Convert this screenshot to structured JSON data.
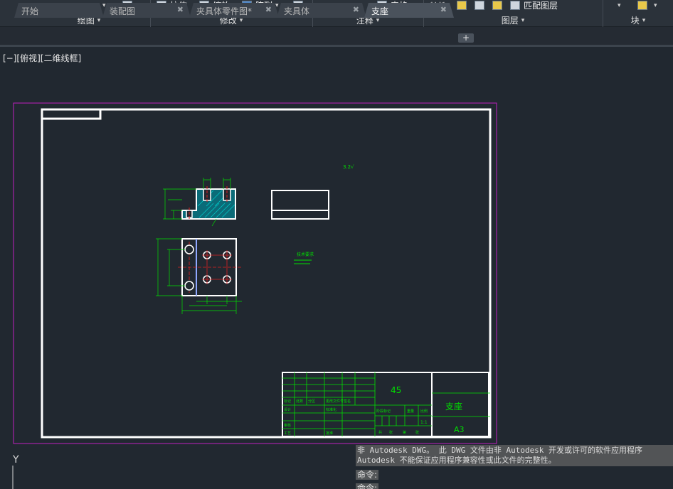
{
  "ribbon": {
    "draw_panel": "绘图",
    "modify_panel": "修改",
    "annotation_panel": "注释",
    "layers_panel": "图层",
    "block_panel": "块",
    "stretch": "拉伸",
    "scale": "缩放",
    "array": "阵列",
    "table": "表格",
    "properties": "特性",
    "match_layer": "匹配图层"
  },
  "tabs": [
    {
      "label": "开始",
      "active": false,
      "closable": false
    },
    {
      "label": "装配图",
      "active": false,
      "closable": true
    },
    {
      "label": "夹具体零件图*",
      "active": false,
      "closable": true
    },
    {
      "label": "夹具体",
      "active": false,
      "closable": true
    },
    {
      "label": "支座",
      "active": true,
      "closable": true
    }
  ],
  "tab_add": "+",
  "tab_close": "✖",
  "viewport_label": "[−][俯视][二维线框]",
  "drawing": {
    "roughness": "3.2√",
    "tech_req": "技术要求",
    "title_block": {
      "material": "45",
      "part_name": "支座",
      "paper_size": "A3",
      "scale": "1:1",
      "row_labels": [
        "标记",
        "处数",
        "分区",
        "更改文件号",
        "签名",
        "设计",
        "审核",
        "工艺",
        "标准化",
        "批准"
      ],
      "stage_labels": [
        "阶段标记",
        "重量",
        "比例"
      ],
      "sheet_labels": [
        "共",
        "张",
        "第",
        "张"
      ]
    }
  },
  "ucs": {
    "y_label": "Y"
  },
  "command": {
    "message_line1": "非 Autodesk DWG。  此 DWG 文件由非 Autodesk 开发或许可的软件应用程序",
    "message_line2": "Autodesk 不能保证应用程序兼容性或此文件的完整性。",
    "prompt1": "命令:",
    "prompt2": "命令:"
  },
  "colors": {
    "background": "#212830",
    "ribbon": "#2b323a",
    "frame": "#ffffff",
    "dimension": "#00e000",
    "hatch": "#00c8c8",
    "viewport_border": "#c020c0",
    "center_line": "#e02020"
  }
}
